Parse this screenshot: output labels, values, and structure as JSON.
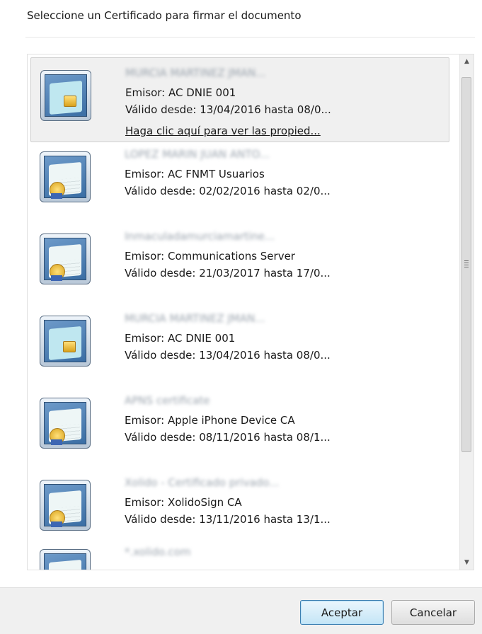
{
  "dialog": {
    "title": "Seleccione un Certificado para firmar el documento"
  },
  "certificates": [
    {
      "name": "MURCIA MARTINEZ JMAN...",
      "issuer": "Emisor: AC DNIE 001",
      "valid": "Válido desde: 13/04/2016 hasta 08/0...",
      "link": "Haga clic aquí para ver las propied...",
      "icon": "smartcard-certificate-icon",
      "selected": true
    },
    {
      "name": "LOPEZ MARIN JUAN ANTO...",
      "issuer": "Emisor: AC FNMT Usuarios",
      "valid": "Válido desde: 02/02/2016 hasta 02/0...",
      "icon": "certificate-seal-icon"
    },
    {
      "name": "Inmaculadamurciamartine...",
      "issuer": "Emisor: Communications Server",
      "valid": "Válido desde: 21/03/2017 hasta 17/0...",
      "icon": "certificate-seal-icon"
    },
    {
      "name": "MURCIA MARTINEZ JMAN...",
      "issuer": "Emisor: AC DNIE 001",
      "valid": "Válido desde: 13/04/2016 hasta 08/0...",
      "icon": "smartcard-certificate-icon"
    },
    {
      "name": "APNS certificate",
      "issuer": "Emisor: Apple iPhone Device CA",
      "valid": "Válido desde: 08/11/2016 hasta 08/1...",
      "icon": "certificate-seal-icon"
    },
    {
      "name": "Xolido - Certificado privado...",
      "issuer": "Emisor: XolidoSign CA",
      "valid": "Válido desde: 13/11/2016 hasta 13/1...",
      "icon": "certificate-seal-icon"
    },
    {
      "name": "*.xolido.com",
      "icon": "certificate-seal-icon"
    }
  ],
  "buttons": {
    "ok": "Aceptar",
    "cancel": "Cancelar"
  }
}
